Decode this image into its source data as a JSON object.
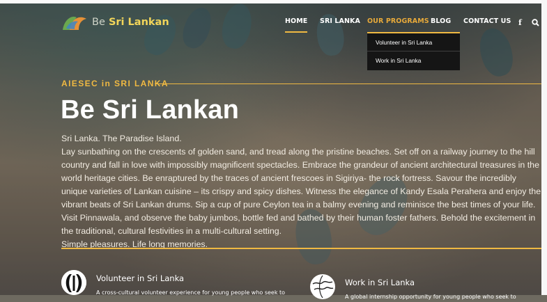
{
  "brand": {
    "logo_text_prefix": "Be",
    "logo_text_main": "Sri Lankan",
    "accent_color": "#f0b942"
  },
  "nav": {
    "items": [
      {
        "label": "HOME"
      },
      {
        "label": "SRI LANKA"
      },
      {
        "label": "OUR PROGRAMS"
      },
      {
        "label": "BLOG"
      },
      {
        "label": "CONTACT US"
      }
    ],
    "icons": [
      "facebook-icon",
      "search-icon"
    ],
    "active_item": "HOME",
    "dropdown": {
      "parent": "OUR PROGRAMS",
      "items": [
        "Volunteer in Sri Lanka",
        "Work in Sri Lanka"
      ]
    }
  },
  "hero": {
    "eyebrow": "AIESEC in SRI LANKA",
    "title": "Be Sri Lankan",
    "paragraph_lines": [
      "Sri Lanka. The Paradise Island.",
      "Lay sunbathing on the crescents of golden sand, and tread along the pristine beaches. Set off on a railway journey to the hill country and fall in love with impossibly magnificent spectacles. Embrace the grandeur of ancient architectural treasures in the world heritage cities. Be enraptured by the traces of ancient frescoes in Sigiriya- the rock fortress. Savour the incredibly unique varieties of Lankan cuisine – its crispy and spicy dishes. Witness the elegance of Kandy Esala Perahera and enjoy the vibrant beats of Sri Lankan drums. Sip a cup of pure Ceylon tea in a balmy evening and reminisce the best times of your life. Visit Pinnawala, and observe the baby jumbos, bottle fed and bathed by their human foster fathers. Behold the excitement in the traditional, cultural festivities in a multi-cultural setting.",
      "Simple pleasures. Life long memories."
    ]
  },
  "programs": [
    {
      "title": "Volunteer in Sri Lanka",
      "description": "A cross-cultural volunteer experience for young people who seek to",
      "icon": "volunteer-icon"
    },
    {
      "title": "Work in Sri Lanka",
      "description": "A global internship opportunity for young people who seek to",
      "icon": "globe-icon"
    }
  ]
}
